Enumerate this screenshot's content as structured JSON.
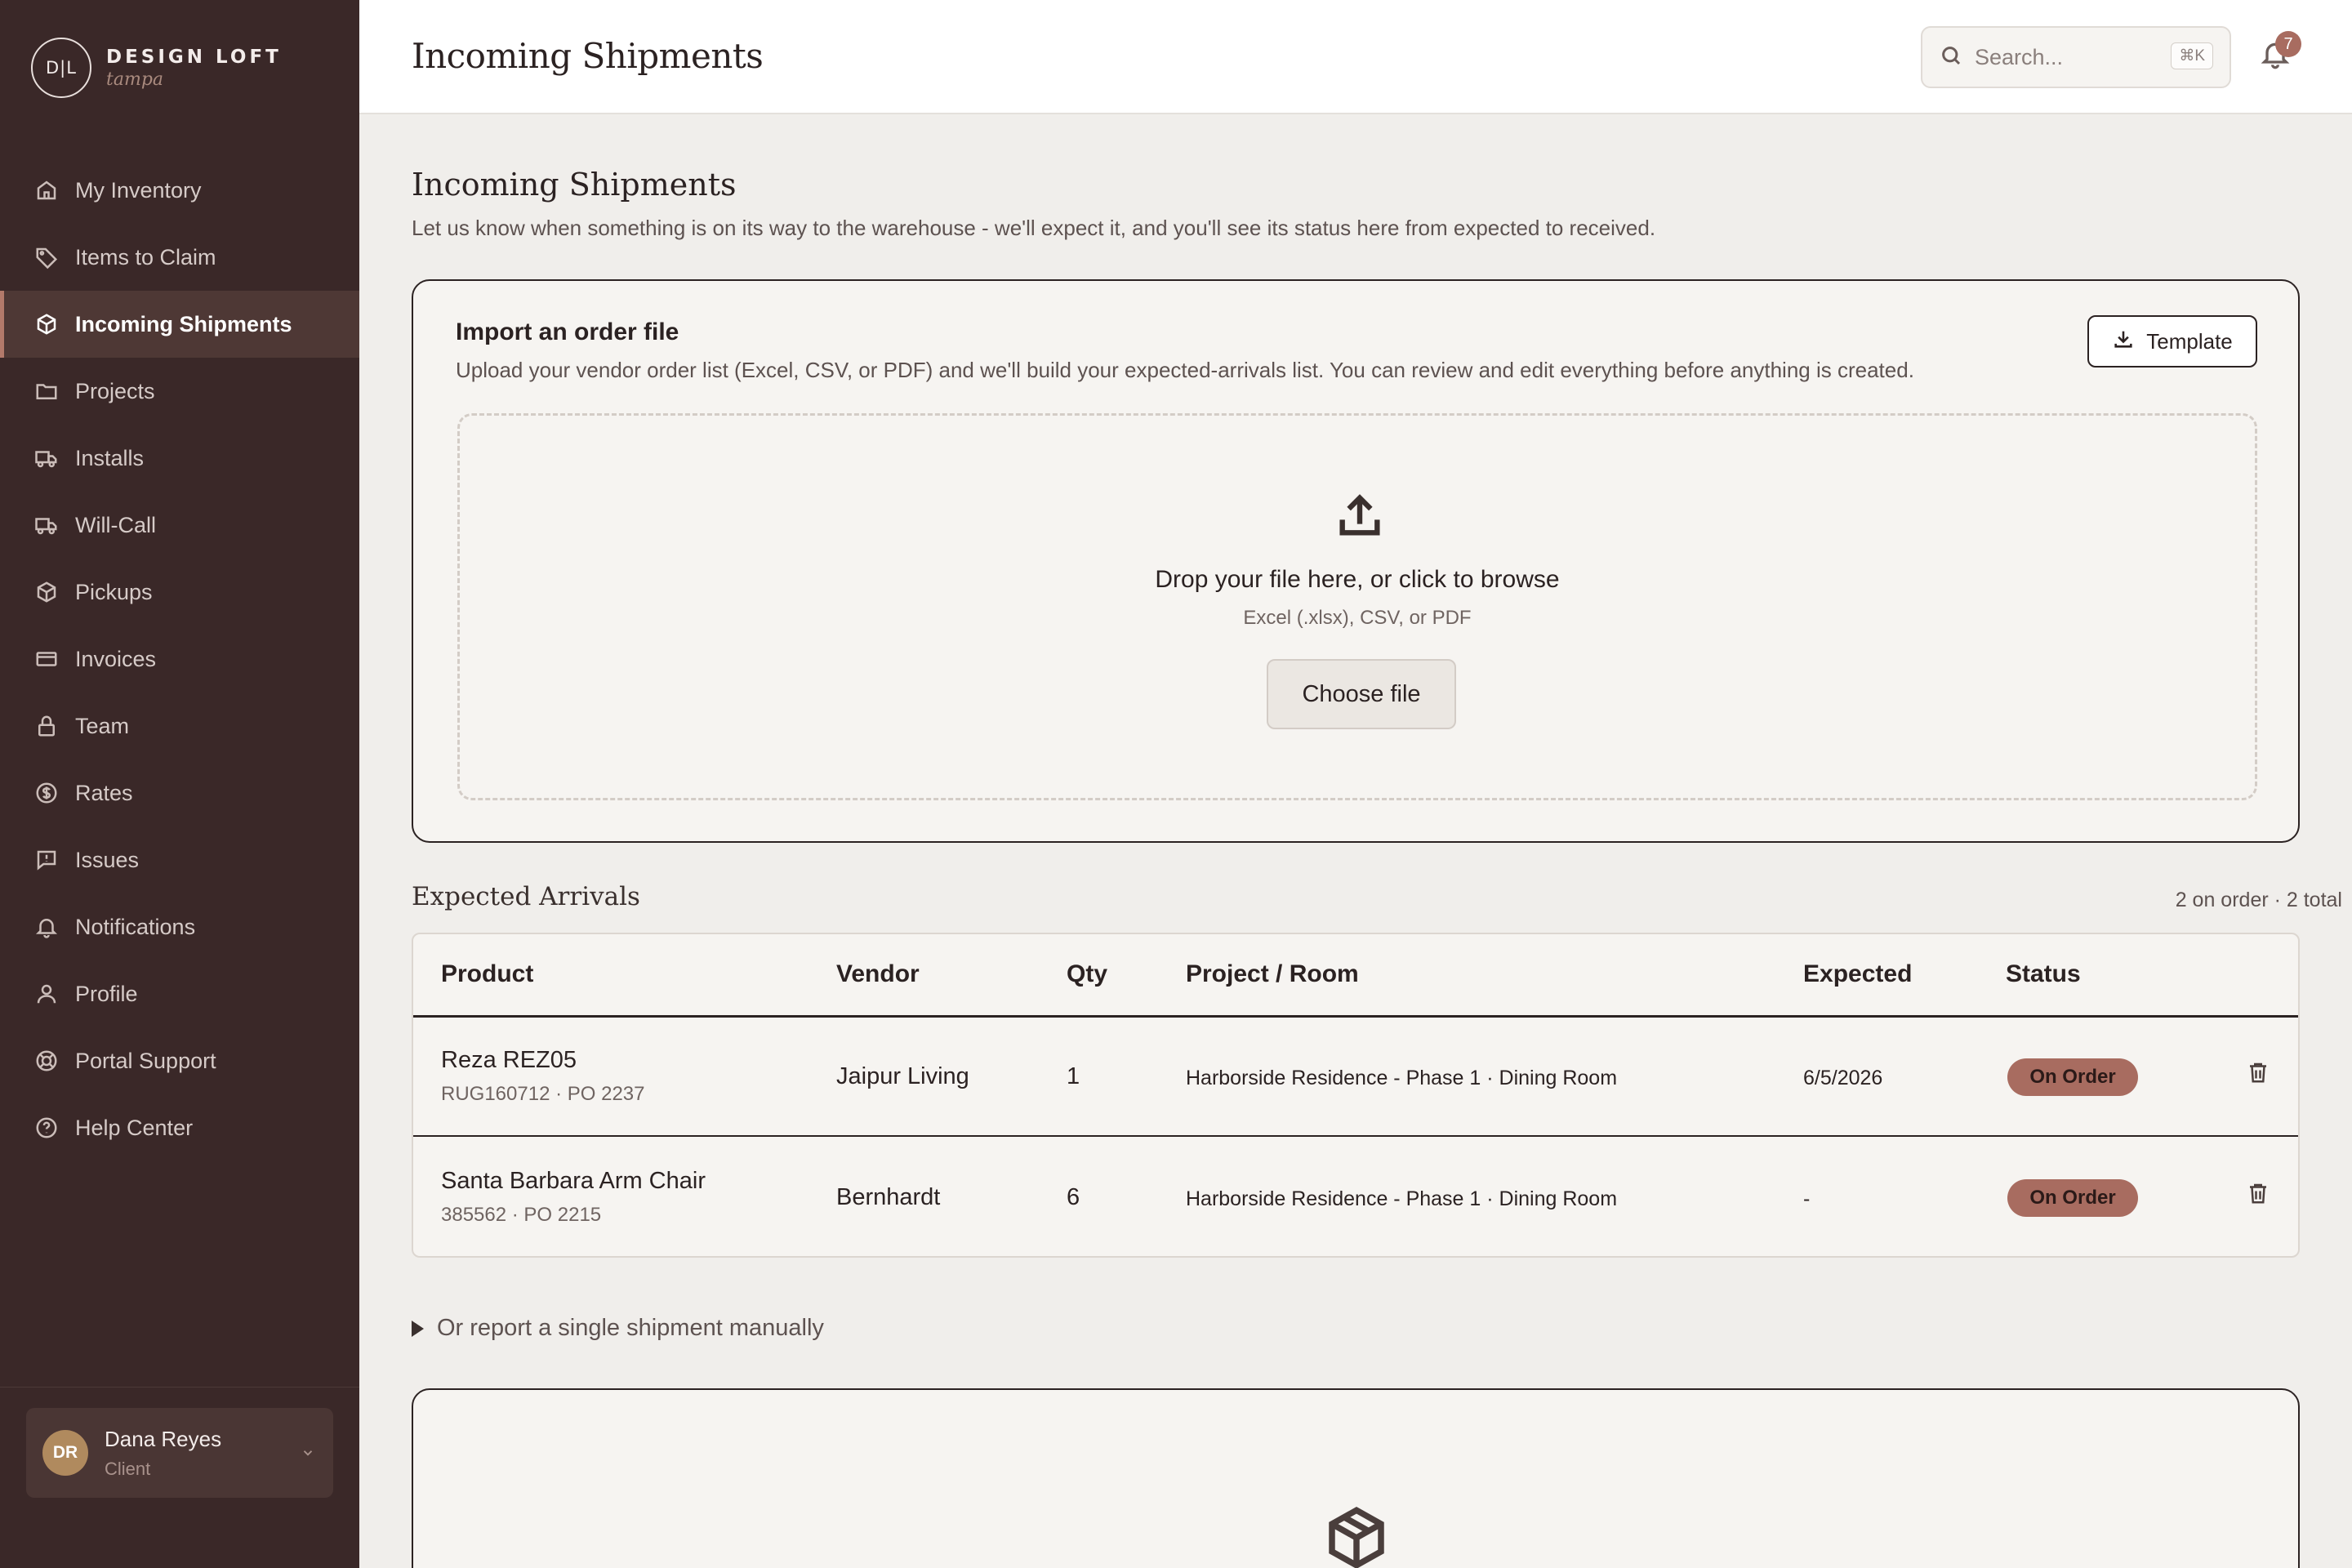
{
  "brand": {
    "monogram": "D|L",
    "name": "DESIGN LOFT",
    "subtitle": "tampa"
  },
  "sidebar": {
    "items": [
      {
        "label": "My Inventory",
        "icon": "home-icon",
        "active": false
      },
      {
        "label": "Items to Claim",
        "icon": "tag-icon",
        "active": false
      },
      {
        "label": "Incoming Shipments",
        "icon": "box-icon",
        "active": true
      },
      {
        "label": "Projects",
        "icon": "folder-icon",
        "active": false
      },
      {
        "label": "Installs",
        "icon": "truck-icon",
        "active": false
      },
      {
        "label": "Will-Call",
        "icon": "truck-icon",
        "active": false
      },
      {
        "label": "Pickups",
        "icon": "box-icon",
        "active": false
      },
      {
        "label": "Invoices",
        "icon": "card-icon",
        "active": false
      },
      {
        "label": "Team",
        "icon": "lock-icon",
        "active": false
      },
      {
        "label": "Rates",
        "icon": "dollar-icon",
        "active": false
      },
      {
        "label": "Issues",
        "icon": "alert-icon",
        "active": false
      },
      {
        "label": "Notifications",
        "icon": "bell-icon",
        "active": false
      },
      {
        "label": "Profile",
        "icon": "user-icon",
        "active": false
      },
      {
        "label": "Portal Support",
        "icon": "lifebuoy-icon",
        "active": false
      },
      {
        "label": "Help Center",
        "icon": "help-icon",
        "active": false
      }
    ],
    "user": {
      "initials": "DR",
      "name": "Dana Reyes",
      "role": "Client"
    }
  },
  "header": {
    "title": "Incoming Shipments",
    "search_placeholder": "Search...",
    "search_shortcut": "⌘K",
    "notification_count": "7"
  },
  "page": {
    "title": "Incoming Shipments",
    "subtitle": "Let us know when something is on its way to the warehouse - we'll expect it, and you'll see its status here from expected to received."
  },
  "import": {
    "title": "Import an order file",
    "description": "Upload your vendor order list (Excel, CSV, or PDF) and we'll build your expected-arrivals list. You can review and edit everything before anything is created.",
    "template_label": "Template",
    "drop_title": "Drop your file here, or click to browse",
    "drop_hint": "Excel (.xlsx), CSV, or PDF",
    "choose_label": "Choose file"
  },
  "arrivals": {
    "title": "Expected Arrivals",
    "count": "2 on order · 2 total",
    "columns": [
      "Product",
      "Vendor",
      "Qty",
      "Project / Room",
      "Expected",
      "Status"
    ],
    "rows": [
      {
        "product": "Reza REZ05",
        "meta": "RUG160712 · PO 2237",
        "vendor": "Jaipur Living",
        "qty": "1",
        "project": "Harborside Residence - Phase 1 · Dining Room",
        "expected": "6/5/2026",
        "status": "On Order"
      },
      {
        "product": "Santa Barbara Arm Chair",
        "meta": "385562 · PO 2215",
        "vendor": "Bernhardt",
        "qty": "6",
        "project": "Harborside Residence - Phase 1 · Dining Room",
        "expected": "-",
        "status": "On Order"
      }
    ]
  },
  "manual": {
    "label": "Or report a single shipment manually"
  },
  "colors": {
    "sidebar": "#3a2828",
    "accent": "#a86c60",
    "status_on_order": "#a86c60",
    "avatar": "#b08a5e"
  }
}
